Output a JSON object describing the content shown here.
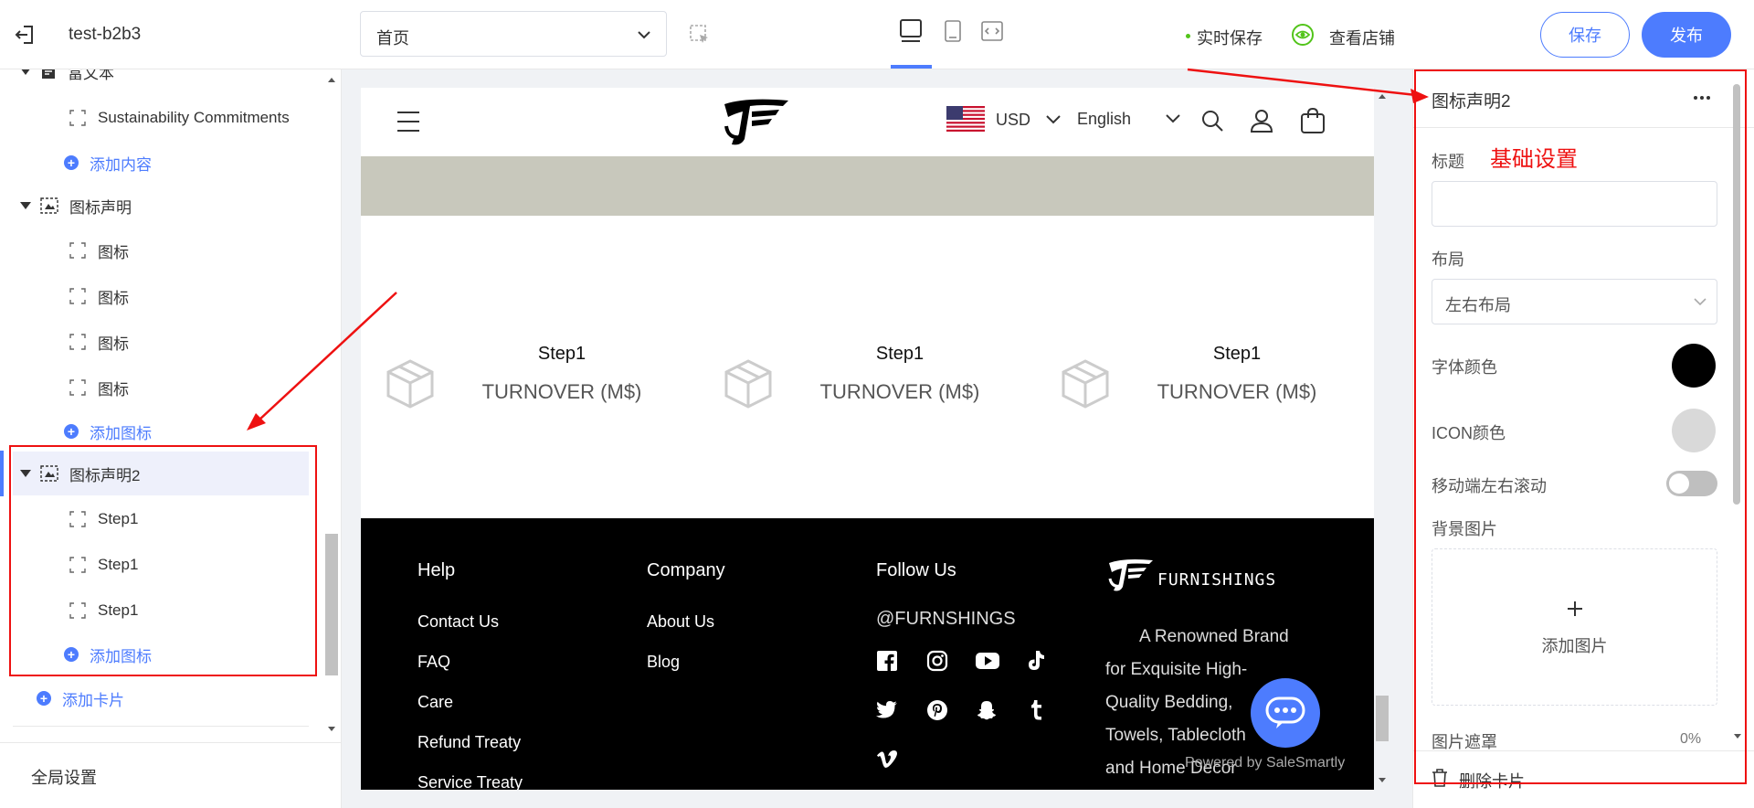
{
  "topbar": {
    "store_name": "test-b2b3",
    "page_select_value": "首页",
    "autosave_label": "实时保存",
    "view_store_label": "查看店铺",
    "save_label": "保存",
    "publish_label": "发布"
  },
  "left_panel": {
    "rich_text_label": "富文本",
    "rich_text_child": "Sustainability Commitments",
    "add_content": "添加内容",
    "icon_statement_label": "图标声明",
    "icon_items": [
      "图标",
      "图标",
      "图标",
      "图标"
    ],
    "add_icon": "添加图标",
    "icon_statement2_label": "图标声明2",
    "step_items": [
      "Step1",
      "Step1",
      "Step1"
    ],
    "add_icon2": "添加图标",
    "add_card": "添加卡片",
    "global_settings": "全局设置"
  },
  "preview": {
    "currency": "USD",
    "language": "English",
    "features": [
      {
        "title": "Step1",
        "subtitle": "TURNOVER (M$)"
      },
      {
        "title": "Step1",
        "subtitle": "TURNOVER (M$)"
      },
      {
        "title": "Step1",
        "subtitle": "TURNOVER (M$)"
      }
    ],
    "footer": {
      "help_heading": "Help",
      "help_links": [
        "Contact Us",
        "FAQ",
        "Care",
        "Refund Treaty",
        "Service Treaty"
      ],
      "company_heading": "Company",
      "company_links": [
        "About Us",
        "Blog"
      ],
      "follow_heading": "Follow Us",
      "handle": "@FURNSHINGS",
      "brand_name": "FURNISHINGS",
      "brand_desc_lines": [
        "A Renowned Brand",
        "for Exquisite High-",
        "Quality Bedding,",
        "Towels, Tablecloth",
        "and Home Decor"
      ],
      "powered_by": "Powered by SaleSmartly"
    }
  },
  "right_panel": {
    "header_title": "图标声明2",
    "section_annotation": "基础设置",
    "title_label": "标题",
    "title_value": "",
    "layout_label": "布局",
    "layout_value": "左右布局",
    "font_color_label": "字体颜色",
    "font_color": "#000000",
    "icon_color_label": "ICON颜色",
    "icon_color": "#d9d9d9",
    "mobile_scroll_label": "移动端左右滚动",
    "mobile_scroll_on": false,
    "bg_image_label": "背景图片",
    "add_image_label": "添加图片",
    "mask_label": "图片遮罩",
    "mask_value": "0%",
    "delete_card": "删除卡片"
  },
  "colors": {
    "accent": "#4d7cfe",
    "annotation_red": "#ee1111",
    "banner_strip": "#c8c8bc",
    "footer_bg": "#000000"
  }
}
